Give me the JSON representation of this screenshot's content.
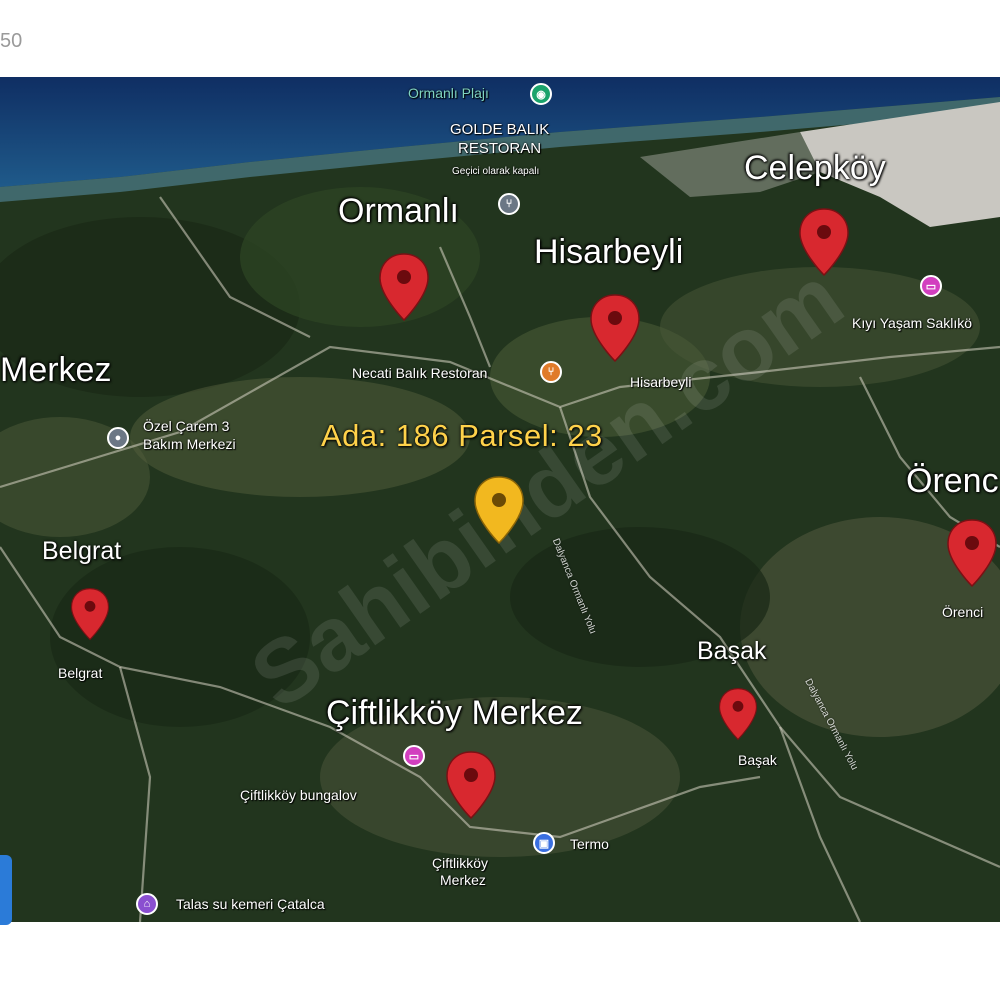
{
  "corner_text": "50",
  "highlight_label": "Ada: 186  Parsel: 23",
  "villages": {
    "ormanli": "Ormanlı",
    "hisarbeyli": "Hisarbeyli",
    "celepkoy": "Celepköy",
    "merkez": "Merkez",
    "orenc": "Örenc",
    "belgrat": "Belgrat",
    "basak": "Başak",
    "ciftlikkoy": "Çiftlikköy Merkez"
  },
  "places": {
    "ormanli_plaji": "Ormanlı Plajı",
    "golde_line1": "GOLDE BALIK",
    "golde_line2": "RESTORAN",
    "golde_status": "Geçici olarak kapalı",
    "kiyi": "Kıyı Yaşam Saklıkö",
    "necati": "Necati Balık Restoran",
    "hisarbeyli_small": "Hisarbeyli",
    "ozel_line1": "Özel Çarem 3",
    "ozel_line2": "Bakım Merkezi",
    "orenc_small": "Örenci",
    "belgrat_small": "Belgrat",
    "basak_small": "Başak",
    "bungalov": "Çiftlikköy bungalov",
    "termo": "Termo",
    "ciftlikkoy_small_1": "Çiftlikköy",
    "ciftlikkoy_small_2": "Merkez",
    "talas": "Talas su kemeri Çatalca"
  },
  "roads": {
    "road1": "Dalyanca Ormanlı Yolu",
    "road2": "Dalyanca Ormanlı Yolu"
  },
  "colors": {
    "pin_red": "#d8282f",
    "pin_yellow": "#f2b81f",
    "poi_green": "#1aa36b",
    "poi_gray": "#6b7785",
    "poi_pink": "#d23fbf",
    "poi_blue": "#3a6fe0",
    "poi_purple": "#8a4fd0"
  },
  "watermark": "Sahibinden.com"
}
